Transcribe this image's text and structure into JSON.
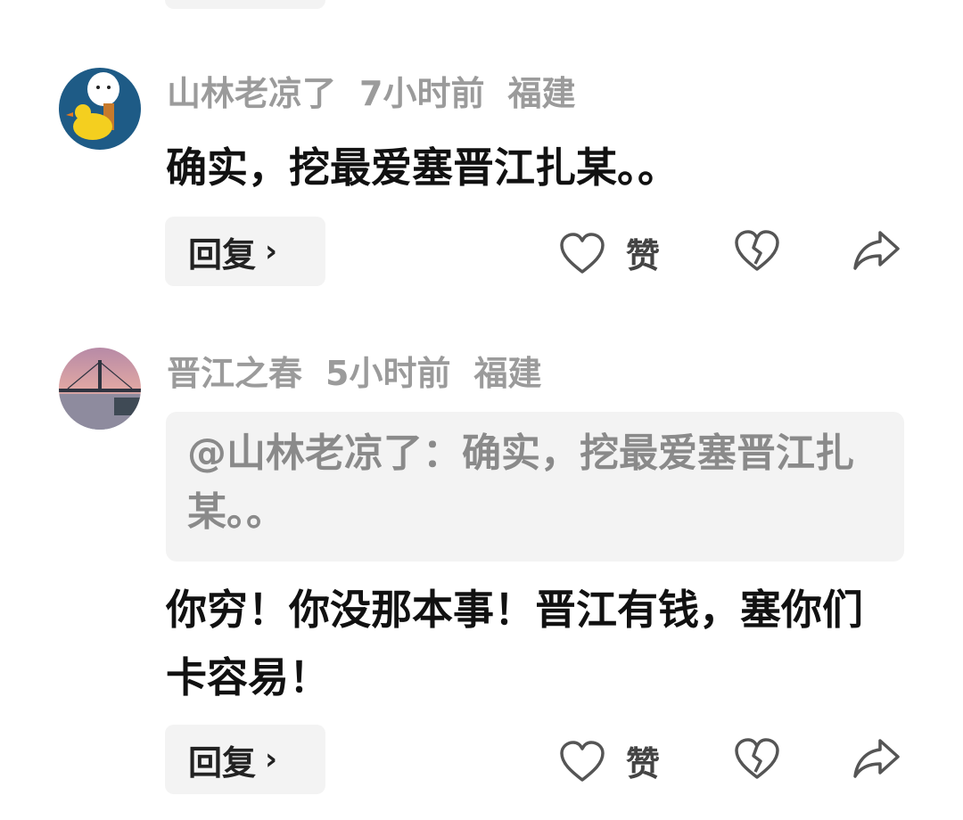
{
  "comments": [
    {
      "username": "山林老凉了",
      "time": "7小时前",
      "location": "福建",
      "text": "确实，挖最爱塞晋江扎某。。",
      "reply_label": "回复",
      "like_label": "赞"
    },
    {
      "username": "晋江之春",
      "time": "5小时前",
      "location": "福建",
      "quote": "@山林老凉了：确实，挖最爱塞晋江扎某。。",
      "text": "你穷！你没那本事！晋江有钱，塞你们卡容易！",
      "reply_label": "回复",
      "like_label": "赞"
    }
  ],
  "icons": {
    "reply_chevron": "chevron-right-icon",
    "like": "heart-icon",
    "dislike": "broken-heart-icon",
    "share": "share-arrow-icon"
  },
  "colors": {
    "meta_text": "#9b9b9b",
    "body_text": "#111111",
    "bubble_bg": "#f3f3f3",
    "icon_stroke": "#555555"
  }
}
